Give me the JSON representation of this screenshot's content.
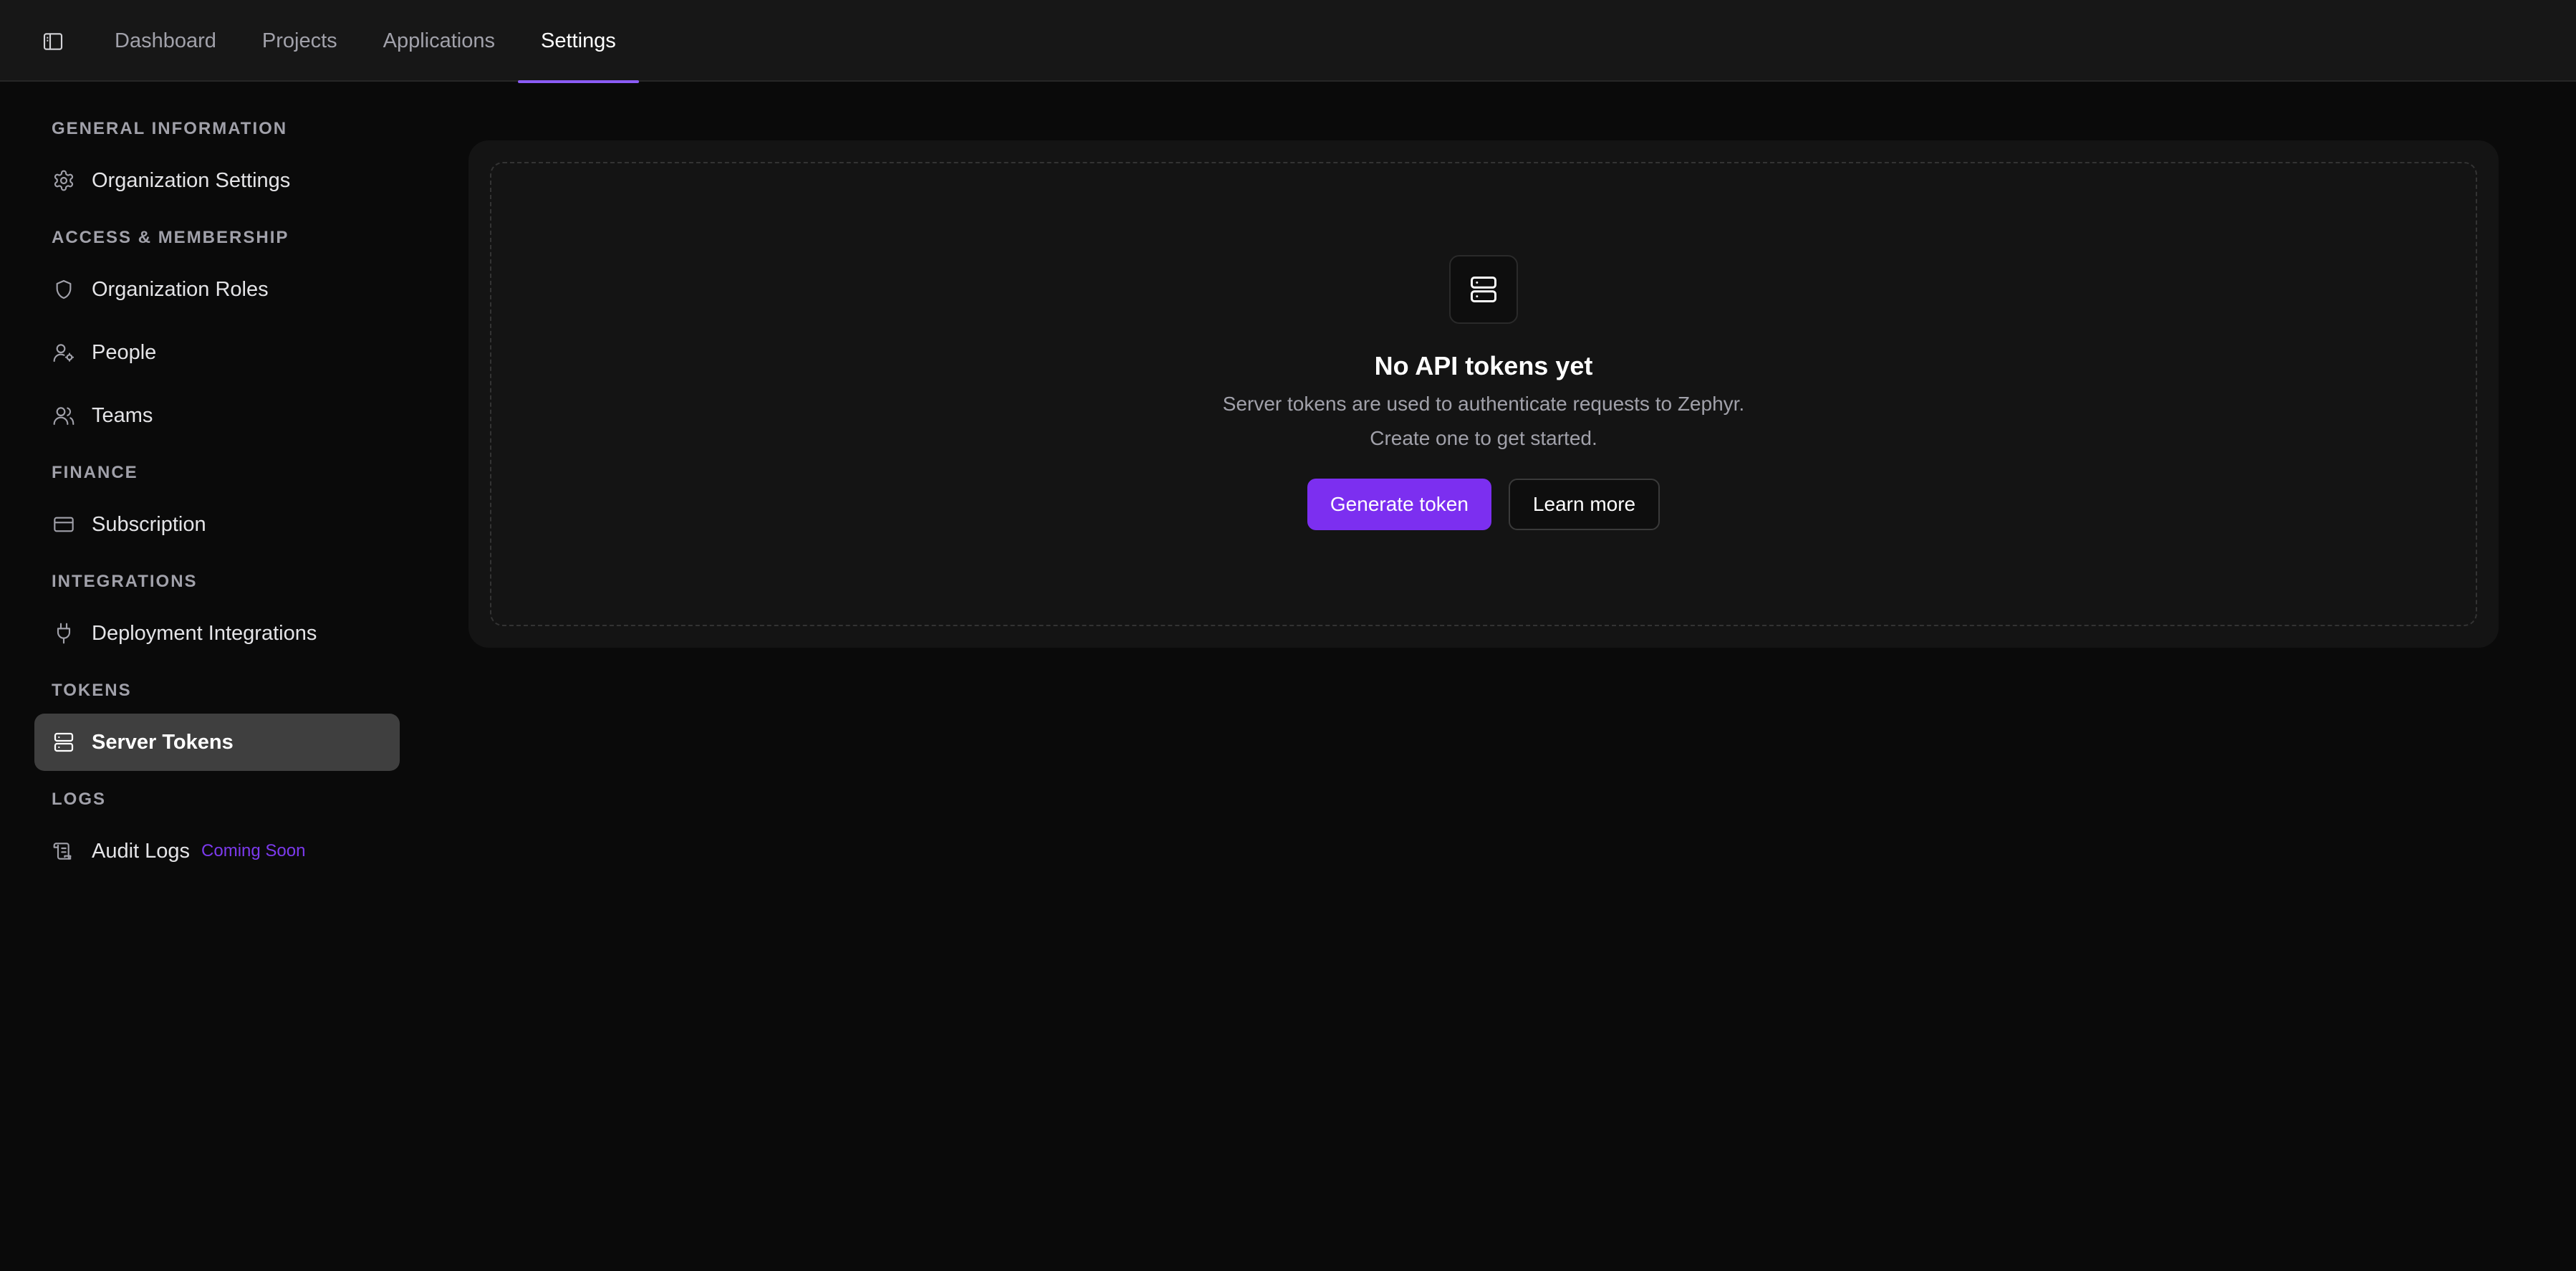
{
  "nav": {
    "toggle_icon": "sidebar-toggle-icon",
    "tabs": [
      {
        "label": "Dashboard",
        "active": false
      },
      {
        "label": "Projects",
        "active": false
      },
      {
        "label": "Applications",
        "active": false
      },
      {
        "label": "Settings",
        "active": true
      }
    ]
  },
  "sidebar": {
    "sections": [
      {
        "label": "GENERAL INFORMATION",
        "items": [
          {
            "label": "Organization Settings",
            "icon": "gear-icon"
          }
        ]
      },
      {
        "label": "ACCESS & MEMBERSHIP",
        "items": [
          {
            "label": "Organization Roles",
            "icon": "shield-icon"
          },
          {
            "label": "People",
            "icon": "user-gear-icon"
          },
          {
            "label": "Teams",
            "icon": "users-icon"
          }
        ]
      },
      {
        "label": "FINANCE",
        "items": [
          {
            "label": "Subscription",
            "icon": "credit-card-icon"
          }
        ]
      },
      {
        "label": "INTEGRATIONS",
        "items": [
          {
            "label": "Deployment Integrations",
            "icon": "plug-icon"
          }
        ]
      },
      {
        "label": "TOKENS",
        "items": [
          {
            "label": "Server Tokens",
            "icon": "server-icon",
            "active": true
          }
        ]
      },
      {
        "label": "LOGS",
        "items": [
          {
            "label": "Audit Logs",
            "icon": "scroll-icon",
            "badge": "Coming Soon"
          }
        ]
      }
    ]
  },
  "main": {
    "empty_state": {
      "icon": "server-icon",
      "title": "No API tokens yet",
      "description_line1": "Server tokens are used to authenticate requests to Zephyr.",
      "description_line2": "Create one to get started.",
      "primary_button": "Generate token",
      "secondary_button": "Learn more"
    }
  },
  "colors": {
    "accent": "#7c2ff0",
    "tab_indicator": "#8b5cf6",
    "badge": "#7c3aed",
    "background": "#0a0a0a",
    "topbar": "#171717",
    "active_item": "#3f3f3f"
  }
}
